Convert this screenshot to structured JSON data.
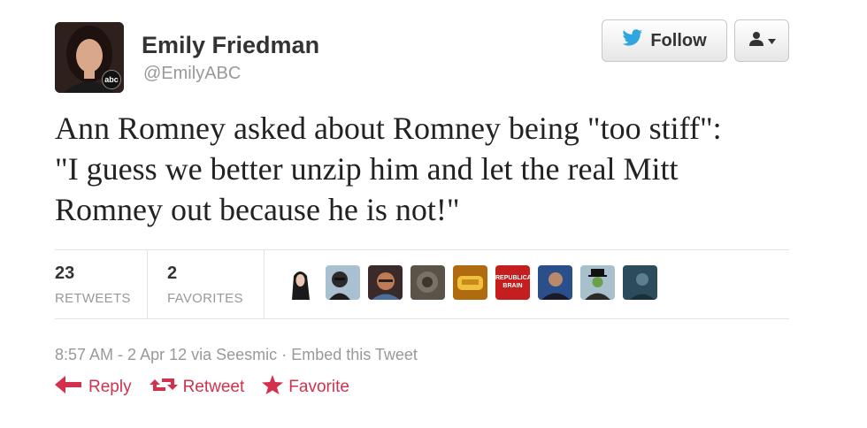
{
  "user": {
    "display_name": "Emily Friedman",
    "screen_name": "@EmilyABC",
    "avatar_badge": "abc"
  },
  "header": {
    "follow_label": "Follow",
    "user_menu_icon": "user-dropdown-icon"
  },
  "tweet": {
    "lines": [
      "Ann Romney asked about Romney being \"too stiff\":",
      "\"I guess we better unzip him and let the real Mitt",
      "Romney out because he is not!\""
    ]
  },
  "stats": {
    "retweets": {
      "count": "23",
      "label": "RETWEETS"
    },
    "favorites": {
      "count": "2",
      "label": "FAVORITES"
    }
  },
  "favoriters": [
    {
      "name": "favoriter-1",
      "color": "#2a2a2a"
    },
    {
      "name": "favoriter-2",
      "color": "#6f8aa0"
    },
    {
      "name": "favoriter-3",
      "color": "#9b5a3c"
    },
    {
      "name": "favoriter-4",
      "color": "#5a5448"
    },
    {
      "name": "favoriter-5",
      "color": "#c8901e"
    },
    {
      "name": "favoriter-6",
      "color": "#c41e1e",
      "text": "REPUBLICAN BRAIN"
    },
    {
      "name": "favoriter-7",
      "color": "#2b4f8a"
    },
    {
      "name": "favoriter-8",
      "color": "#8fa7b4"
    },
    {
      "name": "favoriter-9",
      "color": "#2c4c5c"
    }
  ],
  "meta": {
    "time": "8:57 AM",
    "date": "2 Apr 12",
    "via_prefix": "via",
    "client": "Seesmic",
    "embed": "Embed this Tweet"
  },
  "actions": {
    "reply": "Reply",
    "retweet": "Retweet",
    "favorite": "Favorite",
    "color": "#d3304e"
  }
}
